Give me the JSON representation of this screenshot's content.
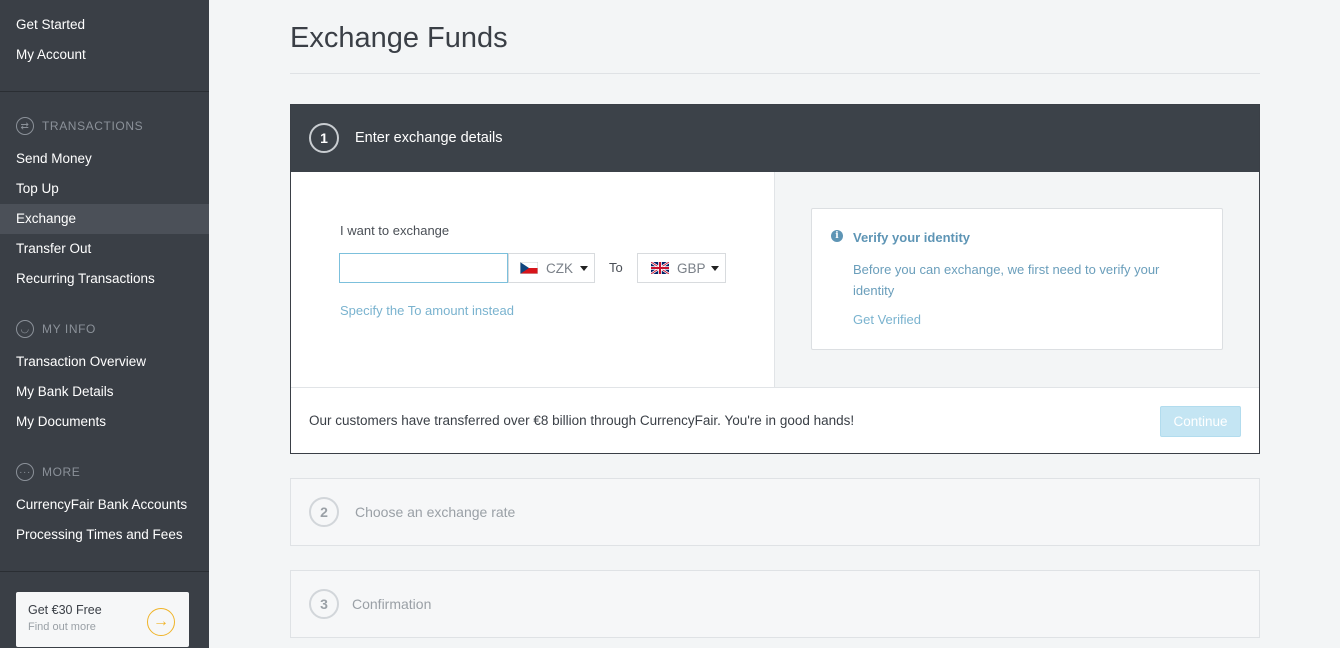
{
  "sidebar": {
    "top_items": [
      "Get Started",
      "My Account"
    ],
    "sections": {
      "transactions": {
        "title": "TRANSACTIONS",
        "icon": "exchange-arrows-icon",
        "items": [
          "Send Money",
          "Top Up",
          "Exchange",
          "Transfer Out",
          "Recurring Transactions"
        ],
        "active": "Exchange"
      },
      "my_info": {
        "title": "MY INFO",
        "icon": "user-icon",
        "items": [
          "Transaction Overview",
          "My Bank Details",
          "My Documents"
        ]
      },
      "more": {
        "title": "MORE",
        "icon": "ellipsis-icon",
        "items": [
          "CurrencyFair Bank Accounts",
          "Processing Times and Fees"
        ]
      }
    },
    "promo": {
      "title": "Get €30 Free",
      "subtitle": "Find out more",
      "icon": "arrow-right-icon",
      "accent": "#f0b429"
    }
  },
  "main": {
    "title": "Exchange Funds",
    "step1": {
      "number": "1",
      "label": "Enter exchange details",
      "want_label": "I want to exchange",
      "amount_value": "",
      "from_currency": "CZK",
      "to_label": "To",
      "to_currency": "GBP",
      "specify_link": "Specify the To amount instead",
      "verify": {
        "icon": "info-icon",
        "title": "Verify your identity",
        "text": "Before you can exchange, we first need to verify your identity",
        "link": "Get Verified"
      },
      "footer_text": "Our customers have transferred over €8 billion through CurrencyFair. You're in good hands!",
      "continue_label": "Continue"
    },
    "step2": {
      "number": "2",
      "label": "Choose an exchange rate"
    },
    "step3": {
      "number": "3",
      "label": "Confirmation"
    }
  },
  "colors": {
    "sidebar_bg": "#3a3f46",
    "header_bg": "#3c4249",
    "link": "#7ab3cf",
    "continue_bg": "#c4e5f3"
  }
}
